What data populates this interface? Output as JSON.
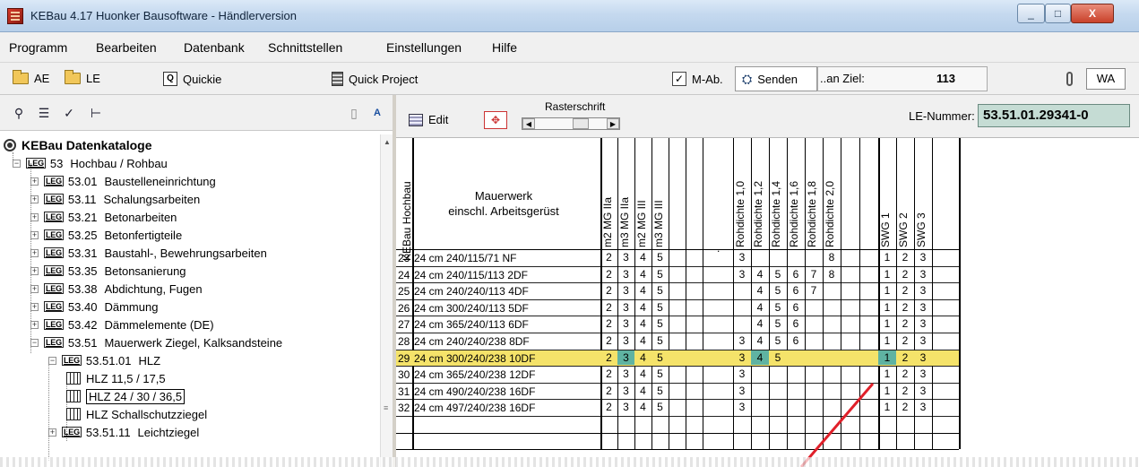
{
  "window": {
    "title": "KEBau 4.17   Huonker Bausoftware - Händlerversion",
    "controls": {
      "minimize": "_",
      "maximize": "□",
      "close": "X"
    }
  },
  "menu": [
    "Programm",
    "Bearbeiten",
    "Datenbank",
    "Schnittstellen",
    "Einstellungen",
    "Hilfe"
  ],
  "toolbar": {
    "ae_label": "AE",
    "le_label": "LE",
    "quickie_label": "Quickie",
    "quick_project_label": "Quick Project",
    "mab_label": "M-Ab.",
    "senden_label": "Senden",
    "an_ziel_label": "..an Ziel:",
    "ziel_number": "113",
    "wa_value": "WA"
  },
  "left_toolbar_icons": [
    "binoculars-icon",
    "list-icon",
    "spellcheck-icon",
    "tree-structure-icon",
    "new-document-icon",
    "font-icon"
  ],
  "tree": {
    "root_label": "KEBau Datenkataloge",
    "leg_tag": "LEG",
    "items": [
      {
        "code": "53",
        "label": "Hochbau / Rohbau",
        "expander": "−"
      },
      {
        "code": "53.01",
        "label": "Baustelleneinrichtung",
        "expander": "+"
      },
      {
        "code": "53.11",
        "label": "Schalungsarbeiten",
        "expander": "+"
      },
      {
        "code": "53.21",
        "label": "Betonarbeiten",
        "expander": "+"
      },
      {
        "code": "53.25",
        "label": "Betonfertigteile",
        "expander": "+"
      },
      {
        "code": "53.31",
        "label": "Baustahl-, Bewehrungsarbeiten",
        "expander": "+"
      },
      {
        "code": "53.35",
        "label": "Betonsanierung",
        "expander": "+"
      },
      {
        "code": "53.38",
        "label": "Abdichtung, Fugen",
        "expander": "+"
      },
      {
        "code": "53.40",
        "label": "Dämmung",
        "expander": "+"
      },
      {
        "code": "53.42",
        "label": "Dämmelemente (DE)",
        "expander": "+"
      },
      {
        "code": "53.51",
        "label": "Mauerwerk Ziegel, Kalksandsteine",
        "expander": "−"
      },
      {
        "code": "53.51.01",
        "label": "HLZ",
        "expander": "−"
      },
      {
        "code": "",
        "label": "HLZ 11,5 / 17,5",
        "expander": ""
      },
      {
        "code": "",
        "label": "HLZ 24 / 30 / 36,5",
        "expander": ""
      },
      {
        "code": "",
        "label": "HLZ Schallschutzziegel",
        "expander": ""
      },
      {
        "code": "53.51.11",
        "label": "Leichtziegel",
        "expander": "+"
      }
    ]
  },
  "right_toolbar": {
    "edit_label": "Edit",
    "raster_label": "Rasterschrift",
    "le_nummer_label": "LE-Nummer:",
    "le_nummer_value": "53.51.01.29341-0"
  },
  "table": {
    "vertical_header_left": "KEBau Hochbau",
    "main_header_line1": "Mauerwerk",
    "main_header_line2": "einschl. Arbeitsgerüst",
    "mg_headers": [
      "m2 MG IIa",
      "m3 MG IIa",
      "m2 MG III",
      "m3 MG III"
    ],
    "rohdichte_headers": [
      "Rohdichte 1,0",
      "Rohdichte 1,2",
      "Rohdichte 1,4",
      "Rohdichte 1,6",
      "Rohdichte 1,8",
      "Rohdichte 2,0"
    ],
    "swg_headers": [
      "SWG 1",
      "SWG 2",
      "SWG 3"
    ],
    "dot_mark": ".",
    "rows": [
      {
        "nr": "23",
        "text": "24 cm 240/115/71   NF",
        "mg": [
          "2",
          "3",
          "4",
          "5"
        ],
        "rd": [
          "3",
          "",
          "",
          "",
          "",
          "8"
        ],
        "swg": [
          "1",
          "2",
          "3"
        ]
      },
      {
        "nr": "24",
        "text": "24 cm 240/115/113  2DF",
        "mg": [
          "2",
          "3",
          "4",
          "5"
        ],
        "rd": [
          "3",
          "4",
          "5",
          "6",
          "7",
          "8"
        ],
        "swg": [
          "1",
          "2",
          "3"
        ]
      },
      {
        "nr": "25",
        "text": "24 cm 240/240/113  4DF",
        "mg": [
          "2",
          "3",
          "4",
          "5"
        ],
        "rd": [
          "",
          "4",
          "5",
          "6",
          "7",
          ""
        ],
        "swg": [
          "1",
          "2",
          "3"
        ]
      },
      {
        "nr": "26",
        "text": "24 cm 300/240/113  5DF",
        "mg": [
          "2",
          "3",
          "4",
          "5"
        ],
        "rd": [
          "",
          "4",
          "5",
          "6",
          "",
          ""
        ],
        "swg": [
          "1",
          "2",
          "3"
        ]
      },
      {
        "nr": "27",
        "text": "24 cm 365/240/113  6DF",
        "mg": [
          "2",
          "3",
          "4",
          "5"
        ],
        "rd": [
          "",
          "4",
          "5",
          "6",
          "",
          ""
        ],
        "swg": [
          "1",
          "2",
          "3"
        ]
      },
      {
        "nr": "28",
        "text": "24 cm 240/240/238  8DF",
        "mg": [
          "2",
          "3",
          "4",
          "5"
        ],
        "rd": [
          "3",
          "4",
          "5",
          "6",
          "",
          ""
        ],
        "swg": [
          "1",
          "2",
          "3"
        ]
      },
      {
        "nr": "29",
        "text": "24 cm 300/240/238  10DF",
        "mg": [
          "2",
          "3",
          "4",
          "5"
        ],
        "rd": [
          "3",
          "4",
          "5",
          "",
          "",
          ""
        ],
        "swg": [
          "1",
          "2",
          "3"
        ]
      },
      {
        "nr": "30",
        "text": "24 cm 365/240/238  12DF",
        "mg": [
          "2",
          "3",
          "4",
          "5"
        ],
        "rd": [
          "3",
          "",
          "",
          "",
          "",
          ""
        ],
        "swg": [
          "1",
          "2",
          "3"
        ]
      },
      {
        "nr": "31",
        "text": "24 cm 490/240/238  16DF",
        "mg": [
          "2",
          "3",
          "4",
          "5"
        ],
        "rd": [
          "3",
          "",
          "",
          "",
          "",
          ""
        ],
        "swg": [
          "1",
          "2",
          "3"
        ]
      },
      {
        "nr": "32",
        "text": "24 cm 497/240/238  16DF",
        "mg": [
          "2",
          "3",
          "4",
          "5"
        ],
        "rd": [
          "3",
          "",
          "",
          "",
          "",
          ""
        ],
        "swg": [
          "1",
          "2",
          "3"
        ]
      }
    ],
    "highlight_row_nr": "29",
    "colors": {
      "highlight": "#f5e36a",
      "selected_cell": "#5fb3a2",
      "le_value_bg": "#c5dcd4",
      "annotation_line": "#e0202a"
    }
  }
}
